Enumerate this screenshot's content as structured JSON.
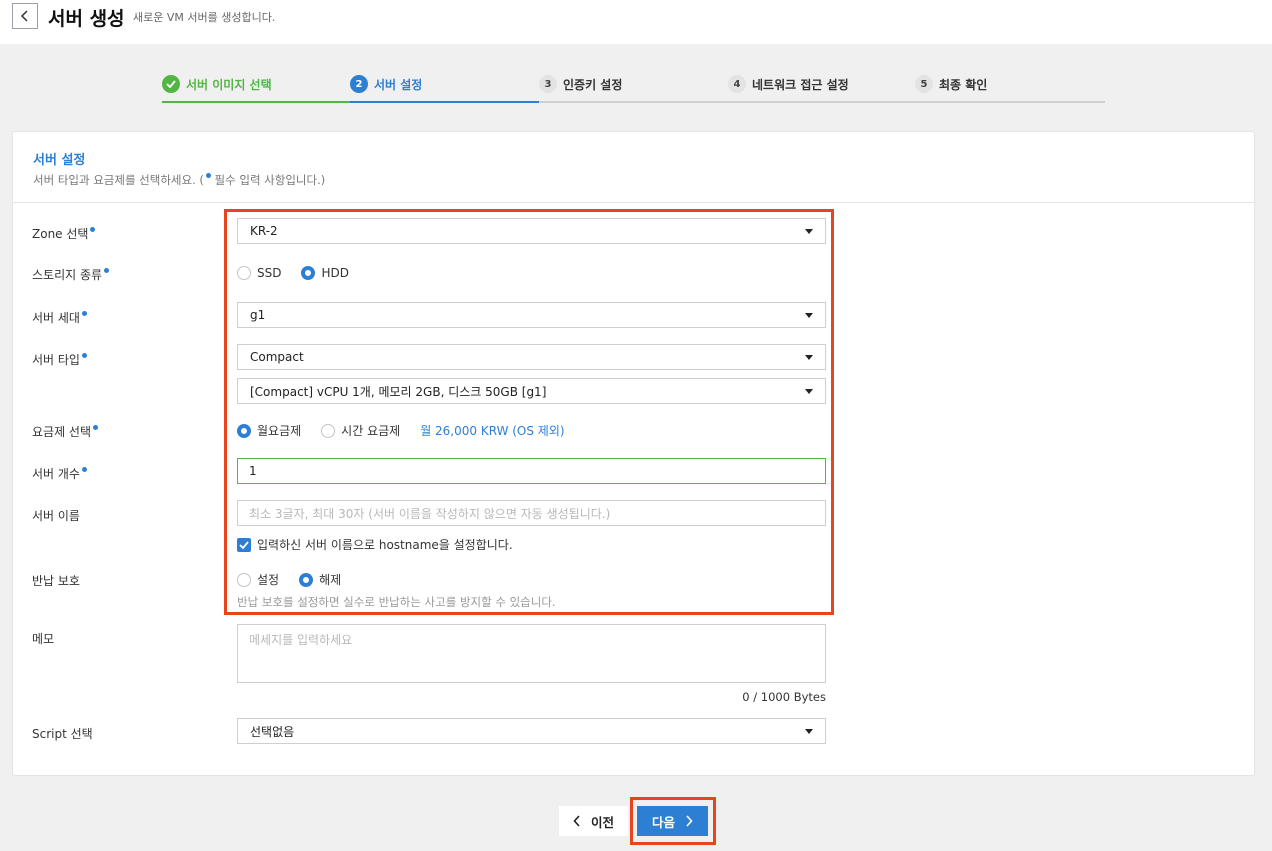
{
  "header": {
    "title": "서버 생성",
    "subtitle": "새로운 VM 서버를 생성합니다."
  },
  "stepper": {
    "steps": [
      {
        "num": "1",
        "label": "서버 이미지 선택",
        "state": "done"
      },
      {
        "num": "2",
        "label": "서버 설정",
        "state": "active"
      },
      {
        "num": "3",
        "label": "인증키 설정",
        "state": "pending"
      },
      {
        "num": "4",
        "label": "네트워크 접근 설정",
        "state": "pending"
      },
      {
        "num": "5",
        "label": "최종 확인",
        "state": "pending"
      }
    ]
  },
  "section": {
    "title": "서버 설정",
    "desc_prefix": "서버 타입과 요금제를 선택하세요. (",
    "desc_suffix": " 필수 입력 사항입니다.)"
  },
  "form": {
    "zone": {
      "label": "Zone 선택",
      "value": "KR-2"
    },
    "storage": {
      "label": "스토리지 종류",
      "options": [
        "SSD",
        "HDD"
      ],
      "selected": "HDD"
    },
    "generation": {
      "label": "서버 세대",
      "value": "g1"
    },
    "server_type": {
      "label": "서버 타입",
      "value": "Compact",
      "spec": "[Compact] vCPU 1개, 메모리 2GB, 디스크 50GB [g1]"
    },
    "plan": {
      "label": "요금제 선택",
      "options": [
        "월요금제",
        "시간 요금제"
      ],
      "selected": "월요금제",
      "price": "월 26,000 KRW (OS 제외)"
    },
    "count": {
      "label": "서버 개수",
      "value": "1"
    },
    "name": {
      "label": "서버 이름",
      "placeholder": "최소 3글자, 최대 30자 (서버 이름을 작성하지 않으면 자동 생성됩니다.)",
      "hostname_checkbox": "입력하신 서버 이름으로 hostname을 설정합니다.",
      "hostname_checked": true
    },
    "protection": {
      "label": "반납 보호",
      "options": [
        "설정",
        "해제"
      ],
      "selected": "해제",
      "hint": "반납 보호를 설정하면 실수로 반납하는 사고를 방지할 수 있습니다."
    },
    "memo": {
      "label": "메모",
      "placeholder": "메세지를 입력하세요",
      "counter": "0 / 1000 Bytes"
    },
    "script": {
      "label": "Script 선택",
      "value": "선택없음"
    }
  },
  "footer": {
    "prev_label": "이전",
    "next_label": "다음"
  },
  "colors": {
    "accent": "#2d7fd3",
    "done": "#52b544",
    "highlight": "#e8451f"
  }
}
